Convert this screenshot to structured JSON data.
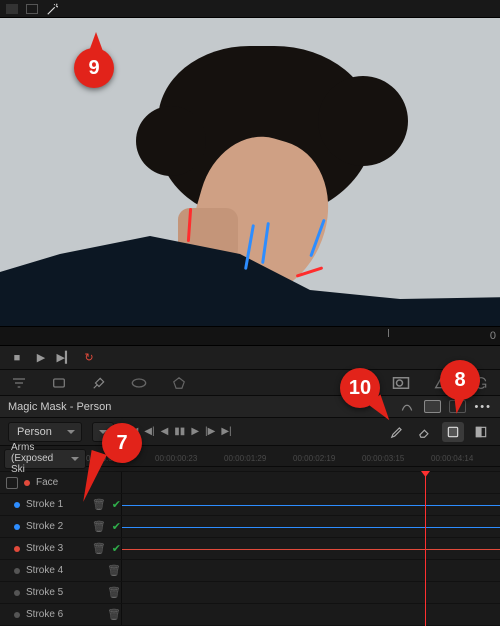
{
  "viewer": {
    "timecode_right": "0"
  },
  "magic_mask": {
    "title": "Magic Mask - Person",
    "mode": "Person",
    "feature_dropdown": "Arms (Exposed Ski"
  },
  "timecodes": [
    "00:00:00:00",
    "00:00:00:23",
    "00:00:01:29",
    "00:00:02:19",
    "00:00:03:15",
    "00:00:04:14"
  ],
  "tracks": {
    "group": "Face",
    "strokes": [
      {
        "name": "Stroke 1",
        "color": "blue",
        "check": true
      },
      {
        "name": "Stroke 2",
        "color": "blue",
        "check": true
      },
      {
        "name": "Stroke 3",
        "color": "red",
        "check": true
      },
      {
        "name": "Stroke 4",
        "color": "",
        "check": false
      },
      {
        "name": "Stroke 5",
        "color": "",
        "check": false
      },
      {
        "name": "Stroke 6",
        "color": "",
        "check": false
      }
    ]
  },
  "callouts": {
    "c7": "7",
    "c8": "8",
    "c9": "9",
    "c10": "10"
  },
  "icons": {
    "stop": "■",
    "play": "▶",
    "next": "▶▎",
    "loop": "↻",
    "skip_first": "|◀",
    "prev_kf": "◀|",
    "step_back": "◀",
    "pause": "▮▮",
    "step_fwd": "▶",
    "next_kf": "|▶",
    "skip_last": "▶|",
    "eraser": "✎",
    "invert": "◩",
    "overlay": "▦",
    "dots": "•••",
    "trash": "🗑",
    "check": "✔"
  }
}
